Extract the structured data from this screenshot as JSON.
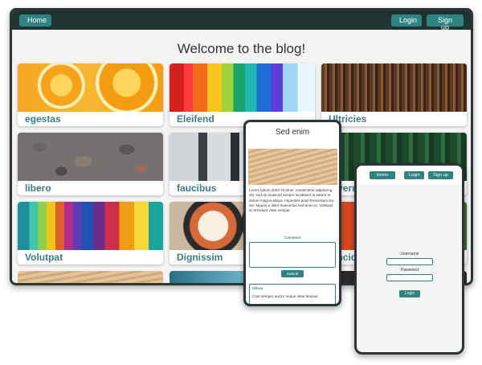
{
  "desktop": {
    "nav": {
      "home": "Home",
      "login": "Login",
      "signup": "Sign up"
    },
    "title": "Welcome to the blog!",
    "cards": [
      {
        "label": "egestas",
        "image": "oranges"
      },
      {
        "label": "Eleifend",
        "image": "paint-streaks"
      },
      {
        "label": "Ultricies",
        "image": "library"
      },
      {
        "label": "libero",
        "image": "stones"
      },
      {
        "label": "faucibus",
        "image": "runners"
      },
      {
        "label": "Viverra",
        "image": "forest"
      },
      {
        "label": "Volutpat",
        "image": "rainbow-stripes"
      },
      {
        "label": "Dignissim",
        "image": "sushi"
      },
      {
        "label": "Tincidunt",
        "image": "flowers"
      }
    ]
  },
  "tablet": {
    "title": "Sed enim",
    "body": "Lorem ipsum dolor sit amet, consectetur adipiscing elit, sed do eiusmod tempor incididunt ut labore et dolore magna aliqua. Imperdiet proin fermentum leo vel. Mauris a diam maecenas sed enim ut. Volutpat ac tincidunt vitae semper.",
    "comment_label": "Comment",
    "submit": "Submit",
    "comment": {
      "author": "Olivia",
      "text": "Cras semper auctor neque vitae tempus"
    }
  },
  "phone": {
    "nav": {
      "home": "Home",
      "login": "Login",
      "signup": "Sign up"
    },
    "username_label": "Username",
    "password_label": "Password",
    "login_button": "Login"
  }
}
